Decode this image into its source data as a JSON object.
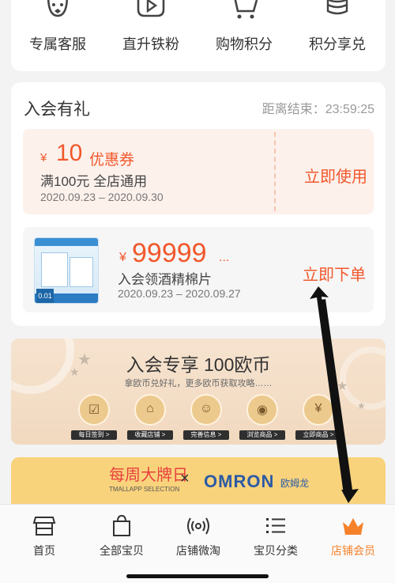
{
  "benefits": [
    {
      "label": "专属客服",
      "icon": "service-robot-icon"
    },
    {
      "label": "直升铁粉",
      "icon": "video-play-icon"
    },
    {
      "label": "购物积分",
      "icon": "shopping-cart-icon"
    },
    {
      "label": "积分享兑",
      "icon": "coin-stack-icon"
    }
  ],
  "gift": {
    "title": "入会有礼",
    "countdown_label": "距离结束：",
    "countdown_time": "23:59:25",
    "coupon": {
      "currency": "¥",
      "amount": "10",
      "type": "优惠券",
      "condition": "满100元 全店通用",
      "dates": "2020.09.23 – 2020.09.30",
      "action": "立即使用"
    },
    "product": {
      "thumb_badge": "0.01",
      "currency": "¥",
      "amount": "99999",
      "ellipsis": "...",
      "name": "入会领酒精棉片",
      "dates": "2020.09.23 – 2020.09.27",
      "action": "立即下单"
    }
  },
  "promo": {
    "title": "入会专享 100欧币",
    "subtitle": "拿欧币兑好礼，更多欧币获取攻略……",
    "items": [
      {
        "label": "每日签到 >",
        "icon": "calendar-check-icon",
        "glyph": "☑"
      },
      {
        "label": "收藏店铺 >",
        "icon": "store-icon",
        "glyph": "⌂"
      },
      {
        "label": "完善信息 >",
        "icon": "profile-icon",
        "glyph": "☺"
      },
      {
        "label": "浏览商品 >",
        "icon": "browse-bag-icon",
        "glyph": "◉"
      },
      {
        "label": "立即商品 >",
        "icon": "yen-coin-icon",
        "glyph": "¥"
      }
    ]
  },
  "brand": {
    "event": "每周大牌日",
    "event_sub": "TMALLAPP SELECTION",
    "times": "×",
    "logo": "OMRON",
    "logo_cn": "欧姆龙"
  },
  "tabs": [
    {
      "label": "首页",
      "icon": "shop-front-icon",
      "active": false
    },
    {
      "label": "全部宝贝",
      "icon": "shopping-bag-icon",
      "active": false
    },
    {
      "label": "店铺微淘",
      "icon": "broadcast-icon",
      "active": false
    },
    {
      "label": "宝贝分类",
      "icon": "list-icon",
      "active": false
    },
    {
      "label": "店铺会员",
      "icon": "crown-icon",
      "active": true
    }
  ],
  "colors": {
    "accent": "#f1582c",
    "active_tab": "#f5822b"
  }
}
